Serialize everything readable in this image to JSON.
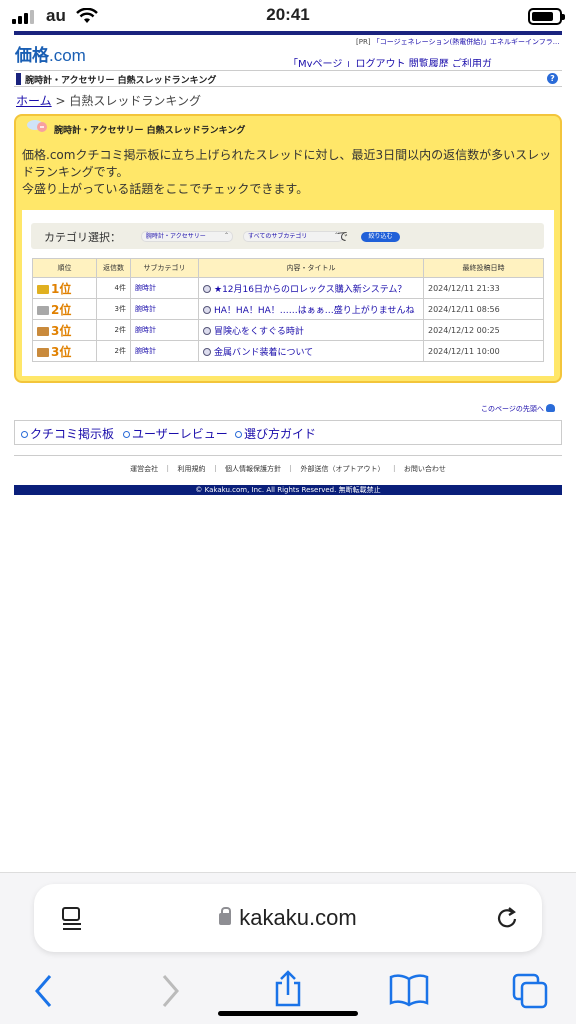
{
  "status": {
    "carrier": "au",
    "time": "20:41"
  },
  "logo": {
    "main": "価格",
    "suffix": ".com"
  },
  "pr": {
    "tag": "[PR]",
    "text": "「コージェネレーション(熱電併給)」エネルギーインフラ..."
  },
  "nav": {
    "text": "「Myページ 」ログアウト 閲覧履歴 ご利用ガ"
  },
  "page_header": {
    "title": "腕時計・アクセサリー 白熱スレッドランキング",
    "help": "?"
  },
  "breadcrumb": {
    "home": "ホーム",
    "sep": " > ",
    "current": "白熱スレッドランキング"
  },
  "panel": {
    "title": "腕時計・アクセサリー 白熱スレッドランキング",
    "desc1": "価格.comクチコミ掲示板に立ち上げられたスレッドに対し、最近3日間以内の返信数が多いスレッドランキングです。",
    "desc2": "今盛り上がっている話題をここでチェックできます。"
  },
  "filter": {
    "label": "カテゴリ選択：",
    "category": "腕時計・アクセサリー",
    "subcategory": "すべてのサブカテゴリ",
    "de": "で",
    "button": "絞り込む"
  },
  "table": {
    "headers": [
      "順位",
      "返信数",
      "サブカテゴリ",
      "内容・タイトル",
      "最終投稿日時"
    ],
    "rows": [
      {
        "rank": "1位",
        "count": "4件",
        "sub": "腕時計",
        "title": "★12月16日からのロレックス購入新システム？",
        "date": "2024/12/11 21:33",
        "crown": "#e0b020"
      },
      {
        "rank": "2位",
        "count": "3件",
        "sub": "腕時計",
        "title": "HA！HA！HA！……はぁぁ…盛り上がりませんね",
        "date": "2024/12/11 08:56",
        "crown": "#a8a8a8"
      },
      {
        "rank": "3位",
        "count": "2件",
        "sub": "腕時計",
        "title": "冒険心をくすぐる時計",
        "date": "2024/12/12 00:25",
        "crown": "#c98a3c"
      },
      {
        "rank": "3位",
        "count": "2件",
        "sub": "腕時計",
        "title": "金属バンド装着について",
        "date": "2024/12/11 10:00",
        "crown": "#c98a3c"
      }
    ]
  },
  "to_top": "このページの先頭へ",
  "tabs": [
    "クチコミ掲示板",
    "ユーザーレビュー",
    "選び方ガイド"
  ],
  "footer": {
    "links": "運営会社 ｜ 利用規約 ｜ 個人情報保護方針 ｜ 外部送信（オプトアウト） ｜ お問い合わせ",
    "copyright": "© Kakaku.com, Inc. All Rights Reserved. 無断転載禁止"
  },
  "safari": {
    "url": "kakaku.com"
  }
}
